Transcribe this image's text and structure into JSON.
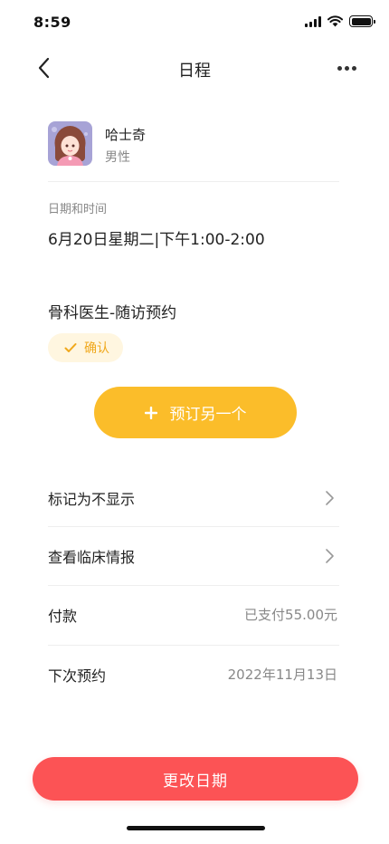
{
  "status": {
    "time": "8:59",
    "icons": [
      "signal-icon",
      "wifi-icon",
      "battery-icon"
    ]
  },
  "nav": {
    "title": "日程",
    "back_icon": "chevron-left-icon",
    "more_icon": "more-horizontal-icon"
  },
  "profile": {
    "name": "哈士奇",
    "gender": "男性"
  },
  "appointment": {
    "datetime_label": "日期和时间",
    "datetime_value": "6月20日星期二|下午1:00-2:00",
    "service": "骨科医生-随访预约",
    "status_badge": "确认"
  },
  "actions": {
    "book_another": "预订另一个",
    "change_date": "更改日期"
  },
  "rows": [
    {
      "label": "标记为不显示",
      "value": "",
      "chevron": true
    },
    {
      "label": "查看临床情报",
      "value": "",
      "chevron": true
    },
    {
      "label": "付款",
      "value": "已支付55.00元",
      "chevron": false
    },
    {
      "label": "下次预约",
      "value": "2022年11月13日",
      "chevron": false
    }
  ],
  "colors": {
    "accent_yellow": "#fbbd2a",
    "badge_bg": "#fff6e0",
    "badge_text": "#f0a81c",
    "danger_red": "#fc5355"
  }
}
